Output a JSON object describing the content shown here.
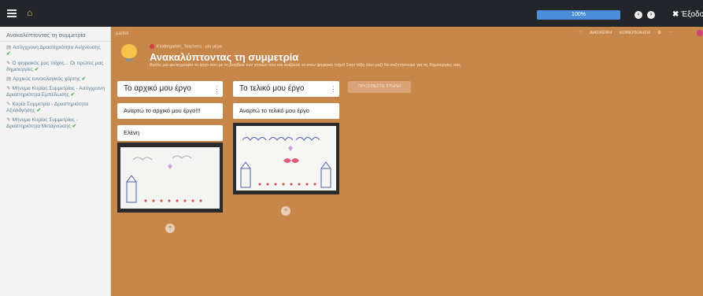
{
  "topbar": {
    "progress_label": "100%",
    "progress_fraction": 1.0,
    "exit_label": "Έξοδο"
  },
  "sidebar": {
    "title": "Ανακαλύπτοντας τη συμμετρία",
    "items": [
      {
        "label": "Ασύγχρονη Δραστηριότητα Ανίχνευσης",
        "checked": true
      },
      {
        "label": "Ο ψηφιακός μας τοίχος... Οι πρώτες μας δημιουργίες",
        "checked": true
      },
      {
        "label": "Αρχικός εννοιολογικός χάρτης",
        "checked": true
      },
      {
        "label": "Μήνυμα Κυρίας Συμμετρίας - Ασύγχρονη Δραστηριότητα Εμπέδωσης",
        "checked": true
      },
      {
        "label": "Κυρία Συμμετρία - Δραστηριότητα Αξιολόγησης",
        "checked": true
      },
      {
        "label": "Μήνυμα Κυρίας Συμμετρίας - Δραστηριότητα Μεταγνώσης",
        "checked": true
      }
    ]
  },
  "board": {
    "top_label": "padlet",
    "header_actions": [
      "ΔΙΑΣΚΕΨΗ",
      "ΚΟΙΝΟΠΟΙΗΣΗ"
    ],
    "author": "Kindergarten_Teachers",
    "time": "μία μέρα",
    "title": "Ανακαλύπτοντας τη συμμετρία",
    "description": "Βγάλε μια φωτογραφία το έργο σου με τη βοήθεια των γονιών σου και ανέβασέ το στον ψηφιακό τοίχο! Στην τάξη όλοι μαζί θα συζητήσουμε για τις δημιουργίες σας.",
    "add_column_label": "ΠΡΟΣΘΕΣΤΕ ΣΤΗΛΗ",
    "columns": [
      {
        "title": "Το αρχικό μου έργο",
        "cards": [
          {
            "title": "Αναρτώ το αρχικό μου έργο!!!"
          },
          {
            "title": "Ελένη"
          }
        ]
      },
      {
        "title": "Το τελικό μου έργο",
        "cards": [
          {
            "title": "Αναρτώ το τελικό μου έργο"
          }
        ]
      }
    ]
  }
}
